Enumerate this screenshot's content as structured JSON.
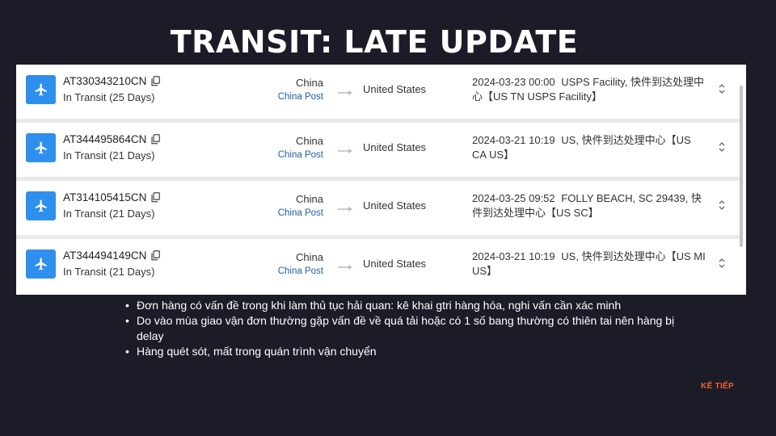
{
  "slide": {
    "title": "TRANSIT: LATE UPDATE",
    "next_label": "KẾ TIẾP"
  },
  "icons": {
    "transport": "airplane-icon",
    "copy": "copy-icon",
    "route": "arrow-right-icon",
    "expand": "expand-chevrons-icon"
  },
  "colors": {
    "background": "#1b1c28",
    "plane_badge": "#2e8fef",
    "carrier_link": "#1f5fa8",
    "next_accent": "#f0622b"
  },
  "shipments": [
    {
      "tracking_number": "AT330343210CN",
      "status": "In Transit (25 Days)",
      "origin": "China",
      "carrier": "China Post",
      "destination": "United States",
      "event_time": "2024-03-23 00:00",
      "event_text": "USPS Facility, 快件到达处理中心【US TN USPS Facility】"
    },
    {
      "tracking_number": "AT344495864CN",
      "status": "In Transit (21 Days)",
      "origin": "China",
      "carrier": "China Post",
      "destination": "United States",
      "event_time": "2024-03-21 10:19",
      "event_text": "US, 快件到达处理中心【US CA US】"
    },
    {
      "tracking_number": "AT314105415CN",
      "status": "In Transit (21 Days)",
      "origin": "China",
      "carrier": "China Post",
      "destination": "United States",
      "event_time": "2024-03-25 09:52",
      "event_text": "FOLLY BEACH, SC 29439, 快件到达处理中心【US SC】"
    },
    {
      "tracking_number": "AT344494149CN",
      "status": "In Transit (21 Days)",
      "origin": "China",
      "carrier": "China Post",
      "destination": "United States",
      "event_time": "2024-03-21 10:19",
      "event_text": "US, 快件到达处理中心【US MI US】"
    }
  ],
  "notes": [
    "Đơn hàng có vấn đề trong khi làm thủ tục hải quan: kê khai gtri hàng hóa, nghi vấn cần xác minh",
    " Do vào mùa giao vận đơn thường gặp vấn đề về quá tải hoặc có 1 số bang thường có thiên tai nên hàng bị delay",
    "Hàng quét sót, mất trong quán trình vận chuyển"
  ]
}
